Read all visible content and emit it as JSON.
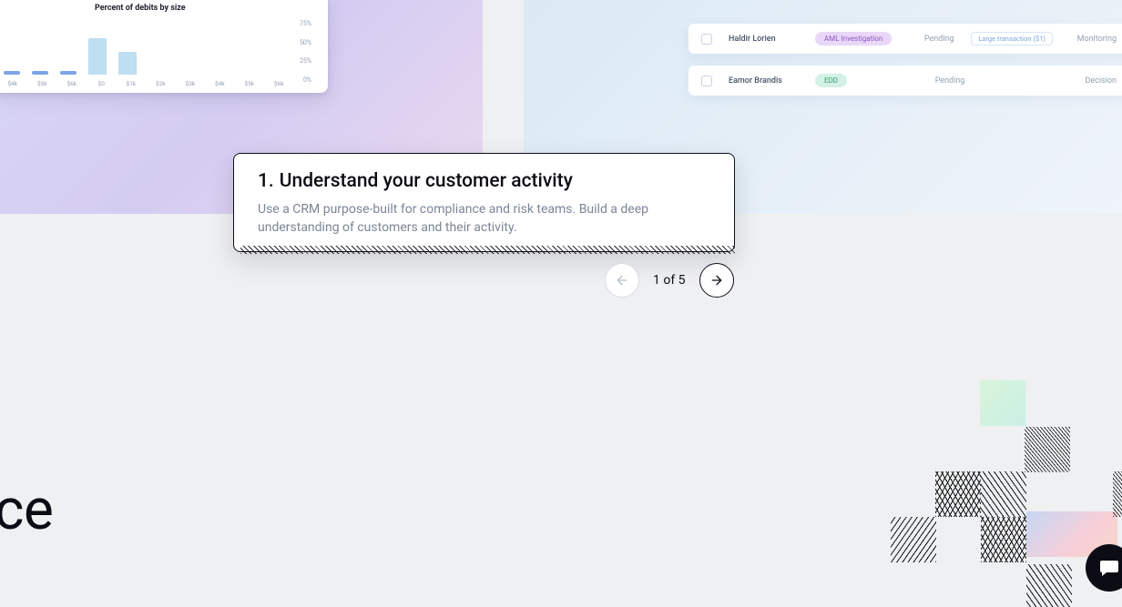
{
  "callout": {
    "number": "1.",
    "title": "Understand your customer activity",
    "body": "Use a CRM purpose-built for compliance and risk teams. Build a deep understanding of customers and their activity."
  },
  "pager": {
    "label": "1 of 5"
  },
  "chart_data": {
    "type": "bar",
    "title": "Percent of debits by size",
    "categories": [
      "$4k",
      "$5k",
      "$6k",
      "$0",
      "$1k",
      "$2k",
      "$3k",
      "$4k",
      "$5k",
      "$6k"
    ],
    "values": [
      4,
      4,
      4,
      50,
      32,
      0,
      0,
      0,
      0,
      0
    ],
    "ylabel": "",
    "xlabel": "",
    "ylim": [
      0,
      75
    ],
    "y_ticks": [
      "75%",
      "50%",
      "25%",
      "0%"
    ]
  },
  "rows": [
    {
      "name": "Haldir Lorien",
      "pill": "AML Investigation",
      "pill_class": "purple",
      "status": "Pending",
      "tag": "Large transaction ($1)",
      "last": "Monitoring"
    },
    {
      "name": "Eamor Brandis",
      "pill": "EDD",
      "pill_class": "green",
      "status": "Pending",
      "tag": "",
      "last": "Decision"
    }
  ],
  "fragment_text": "ce",
  "icons": {
    "prev": "arrow-left-icon",
    "next": "arrow-right-icon",
    "chat": "chat-icon"
  }
}
